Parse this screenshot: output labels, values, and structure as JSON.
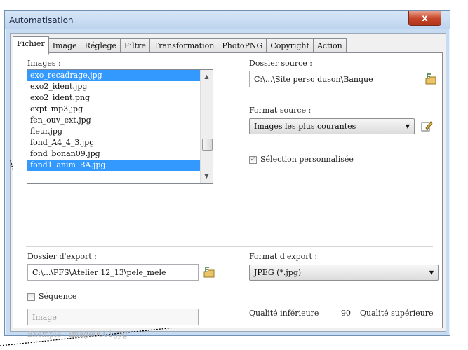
{
  "header_text": "",
  "window": {
    "title": "Automatisation",
    "close_glyph": "x"
  },
  "tabs": [
    "Fichier",
    "Image",
    "Réglege",
    "Filtre",
    "Transformation",
    "PhotoPNG",
    "Copyright",
    "Action"
  ],
  "images": {
    "label": "Images :",
    "files": [
      "exo_recadrage.jpg",
      "exo2_ident.jpg",
      "exo2_ident.png",
      "expt_mp3.jpg",
      "fen_ouv_ext.jpg",
      "fleur.jpg",
      "fond_A4_4_3.jpg",
      "fond_bonan09.jpg",
      "fond1_anim_BA.jpg"
    ],
    "selected_rows": [
      0,
      8
    ]
  },
  "source_folder": {
    "label": "Dossier source :",
    "value": "C:\\...\\Site perso duson\\Banque"
  },
  "source_format": {
    "label": "Format source :",
    "value": "Images les plus courantes"
  },
  "custom_selection": {
    "label": "Sélection personnalisée",
    "checked": true
  },
  "export_folder": {
    "label": "Dossier d'export :",
    "value": "C:\\...\\PFS\\Atelier 12_13\\pele_mele"
  },
  "export_format": {
    "label": "Format d'export :",
    "value": "JPEG (*.jpg)"
  },
  "sequence": {
    "label": "Séquence",
    "checked": false,
    "value": "Image",
    "example": "Exemple : Image0001.jpg"
  },
  "quality": {
    "low_label": "Qualité inférieure",
    "value": "90",
    "high_label": "Qualité supérieure",
    "level": 0.9
  },
  "colors": {
    "selection": "#3399ff",
    "titlebar": "#c7dcf3",
    "close": "#c7472b"
  }
}
